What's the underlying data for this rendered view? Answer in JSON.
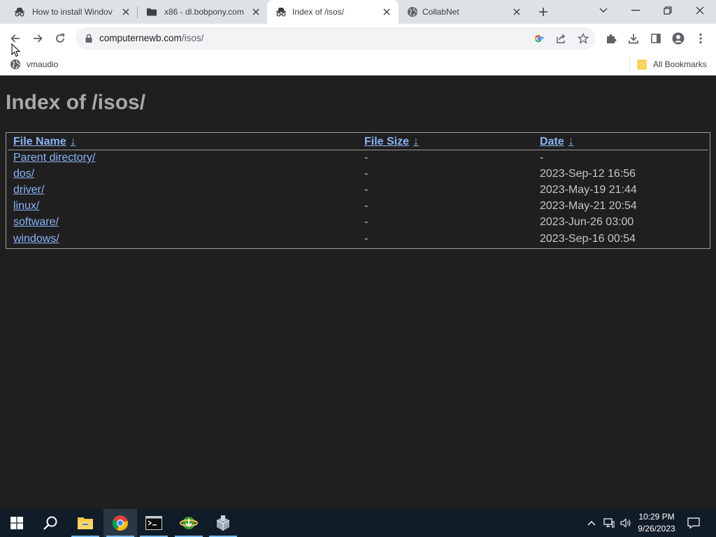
{
  "tabs": [
    {
      "title": "How to install Windov",
      "icon": "incognito-icon",
      "active": false
    },
    {
      "title": "x86 - dl.bobpony.com",
      "icon": "folder-icon",
      "active": false
    },
    {
      "title": "Index of /isos/",
      "icon": "incognito-icon",
      "active": true
    },
    {
      "title": "CollabNet",
      "icon": "globe-icon",
      "active": false
    }
  ],
  "address": {
    "host": "computernewb.com",
    "path": "/isos/"
  },
  "bookmarks": {
    "left_item": "vmaudio",
    "right_item": "All Bookmarks"
  },
  "page": {
    "title": "Index of /isos/",
    "headers": {
      "name": "File Name",
      "size": "File Size",
      "date": "Date",
      "arrow": "↓"
    },
    "rows": [
      {
        "name": "Parent directory/",
        "size": "-",
        "date": "-"
      },
      {
        "name": "dos/",
        "size": "-",
        "date": "2023-Sep-12 16:56"
      },
      {
        "name": "driver/",
        "size": "-",
        "date": "2023-May-19 21:44"
      },
      {
        "name": "linux/",
        "size": "-",
        "date": "2023-May-21 20:54"
      },
      {
        "name": "software/",
        "size": "-",
        "date": "2023-Jun-26 03:00"
      },
      {
        "name": "windows/",
        "size": "-",
        "date": "2023-Sep-16 00:54"
      }
    ]
  },
  "taskbar": {
    "time": "10:29 PM",
    "date": "9/26/2023"
  },
  "colors": {
    "page_bg": "#1f1f1f",
    "link": "#8ab4f8",
    "heading": "#a8a8a8",
    "taskbar": "#101c28"
  }
}
